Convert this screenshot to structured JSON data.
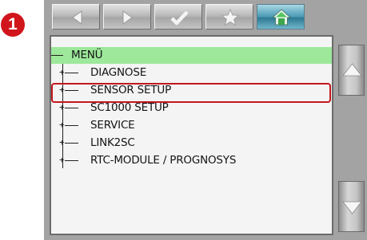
{
  "step": {
    "number": "1"
  },
  "toolbar": {
    "buttons": [
      {
        "icon": "arrow-left-icon"
      },
      {
        "icon": "arrow-right-icon"
      },
      {
        "icon": "checkmark-icon"
      },
      {
        "icon": "star-icon"
      },
      {
        "icon": "home-icon",
        "active": true
      }
    ]
  },
  "menu": {
    "root_label": "MENÜ",
    "items": [
      {
        "label": "DIAGNOSE"
      },
      {
        "label": "SENSOR SETUP",
        "selected": true
      },
      {
        "label": "SC1000 SETUP"
      },
      {
        "label": "SERVICE"
      },
      {
        "label": "LINK2SC"
      },
      {
        "label": "RTC-MODULE / PROGNOSYS"
      }
    ]
  },
  "scroll": {
    "up_icon": "arrow-up-icon",
    "down_icon": "arrow-down-icon"
  },
  "colors": {
    "root_highlight": "#9de89a",
    "selection_border": "#c4161e",
    "badge": "#d0161c",
    "home_button": "#3f8ba6"
  }
}
